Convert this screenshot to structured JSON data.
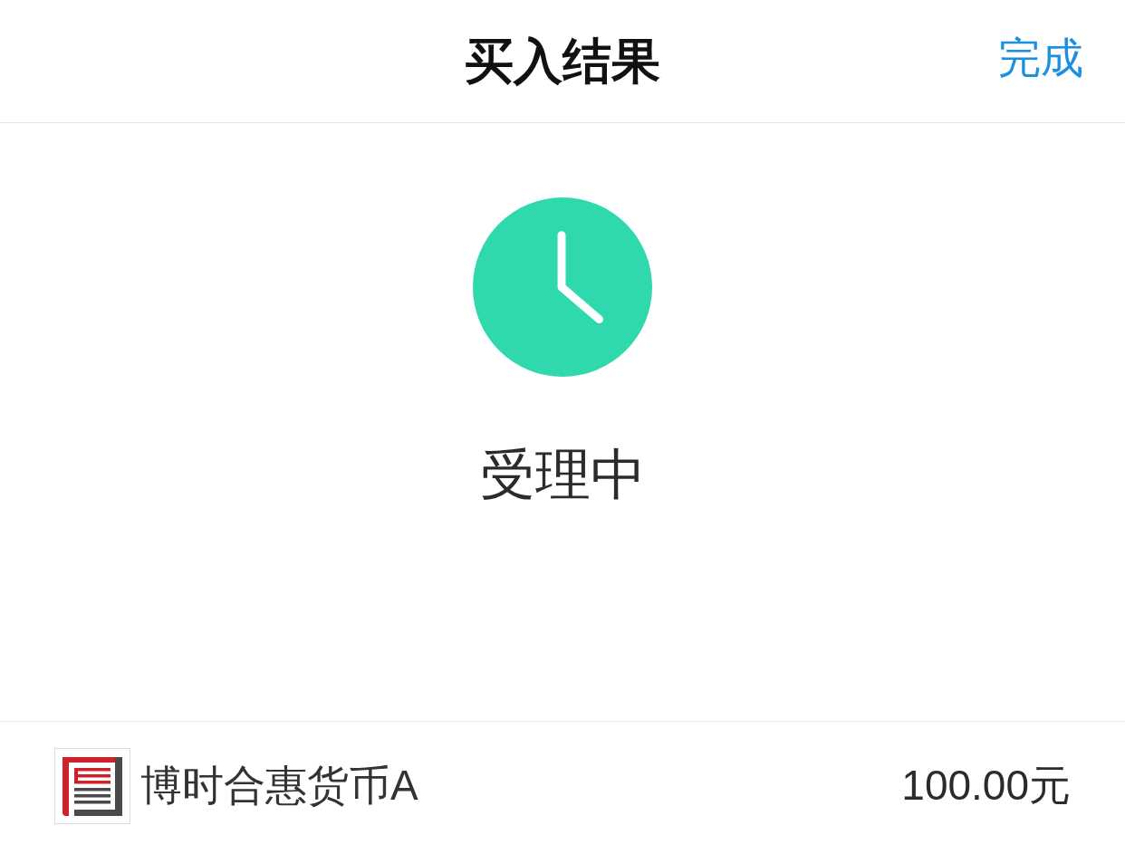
{
  "nav_bar": {
    "title": "买入结果",
    "done_button": "完成"
  },
  "result": {
    "kind": "pending",
    "status": "受理中"
  },
  "fund": {
    "name": "博时合惠货币A",
    "amount": "100.00元"
  }
}
